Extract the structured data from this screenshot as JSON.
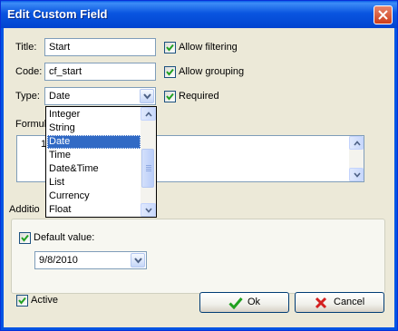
{
  "window": {
    "title": "Edit Custom Field"
  },
  "fields": {
    "title_label": "Title:",
    "title_value": "Start",
    "code_label": "Code:",
    "code_value": "cf_start",
    "type_label": "Type:",
    "type_value": "Date"
  },
  "checks": {
    "allow_filtering": {
      "label": "Allow filtering",
      "checked": true
    },
    "allow_grouping": {
      "label": "Allow grouping",
      "checked": true
    },
    "required": {
      "label": "Required",
      "checked": true
    }
  },
  "formula": {
    "label": "Formul",
    "line_number": "1"
  },
  "additional": {
    "label": "Additio",
    "default_value_label": "Default value:",
    "default_value_checked": true,
    "date_value": "9/8/2010"
  },
  "type_dropdown": {
    "options": [
      "Integer",
      "String",
      "Date",
      "Time",
      "Date&Time",
      "List",
      "Currency",
      "Float"
    ],
    "selected_index": 2
  },
  "active": {
    "label": "Active",
    "checked": true
  },
  "buttons": {
    "ok": "Ok",
    "cancel": "Cancel"
  },
  "icons": {
    "ok": "green-check-icon",
    "cancel": "red-x-icon",
    "close": "close-icon"
  },
  "colors": {
    "titlebar": "#0054e3",
    "selection": "#316ac5",
    "face": "#ece9d8"
  }
}
